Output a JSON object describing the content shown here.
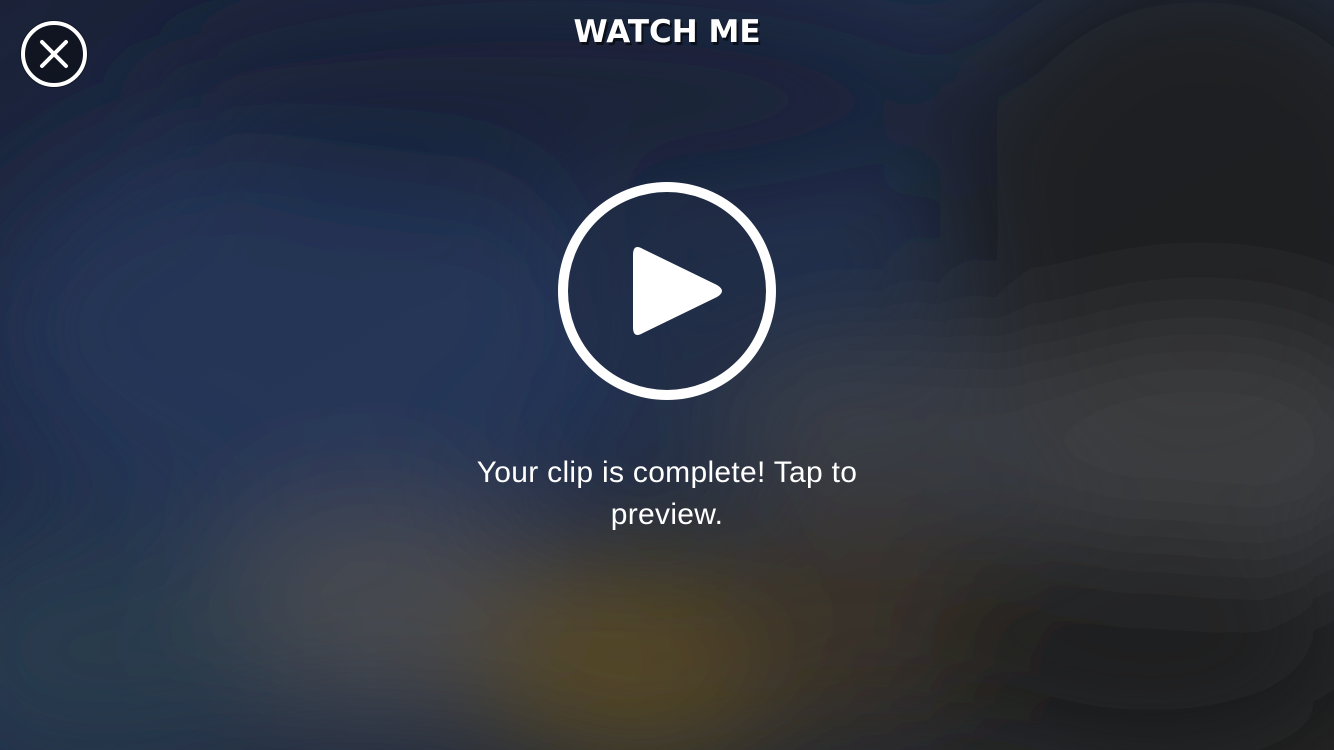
{
  "header": {
    "title": "WATCH ME",
    "close_icon": "close-icon"
  },
  "preview": {
    "play_icon": "play-icon",
    "message": "Your clip is complete! Tap to preview."
  },
  "colors": {
    "foreground": "#ffffff",
    "background_top": "#1c2438",
    "background_right": "#222222",
    "accent_blur": "#5a4a24"
  }
}
